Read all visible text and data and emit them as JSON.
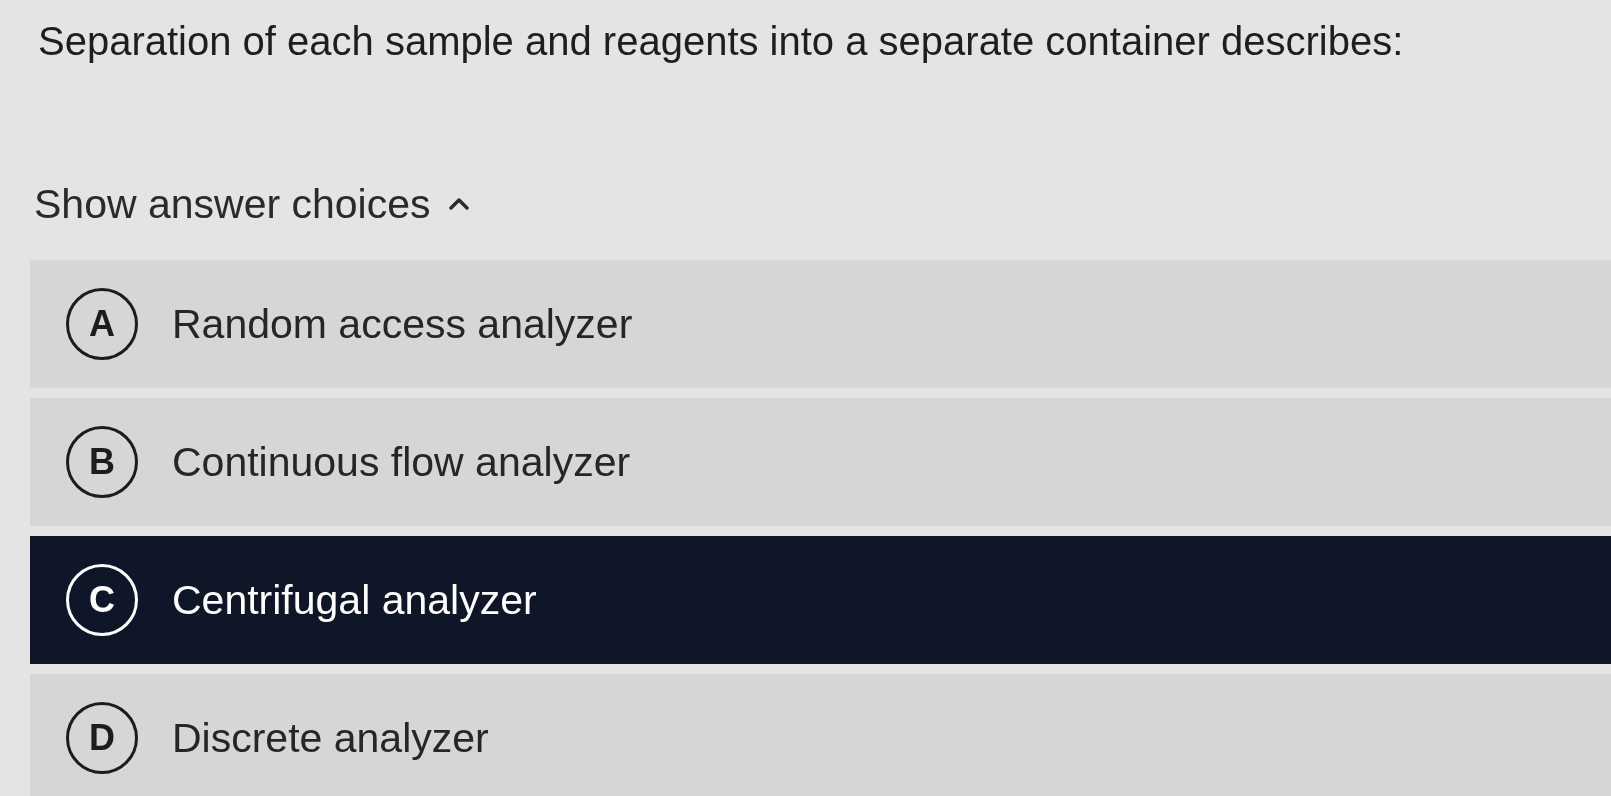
{
  "question": "Separation of each sample and reagents into a separate container describes:",
  "toggle": {
    "label": "Show answer choices",
    "expanded": true
  },
  "choices": [
    {
      "letter": "A",
      "text": "Random access analyzer",
      "selected": false
    },
    {
      "letter": "B",
      "text": "Continuous flow analyzer",
      "selected": false
    },
    {
      "letter": "C",
      "text": "Centrifugal analyzer",
      "selected": true
    },
    {
      "letter": "D",
      "text": "Discrete analyzer",
      "selected": false
    }
  ]
}
